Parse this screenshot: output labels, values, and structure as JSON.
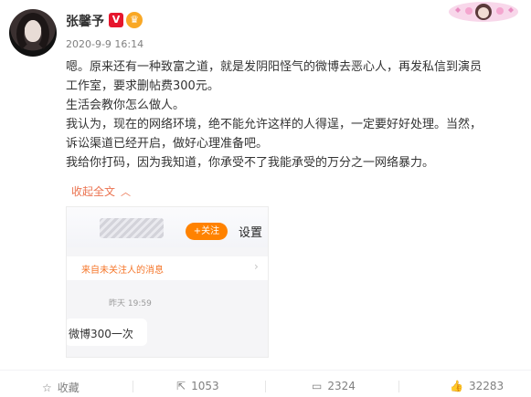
{
  "user": {
    "name": "张馨予",
    "verified_badge": "V",
    "fan_badge": "♛",
    "timestamp": "2020-9-9 16:14"
  },
  "post": {
    "lines": [
      "嗯。原来还有一种致富之道，就是发阴阳怪气的微博去恶心人，再发私信到演员",
      "工作室，要求删帖费300元。",
      "生活会教你怎么做人。",
      "我认为，现在的网络环境，绝不能允许这样的人得逞，一定要好好处理。当然，",
      "诉讼渠道已经开启，做好心理准备吧。",
      "我给你打码，因为我知道，你承受不了我能承受的万分之一网络暴力。"
    ],
    "collapse_label": "收起全文",
    "collapse_icon": "chevron-up-icon"
  },
  "screenshot": {
    "follow_label": "+关注",
    "settings_label": "设置",
    "notice_text": "来自未关注人的消息",
    "chat_time": "昨天 19:59",
    "message": "微博300一次"
  },
  "footer": {
    "favorite_label": "收藏",
    "repost_count": "1053",
    "comment_count": "2324",
    "like_count": "32283"
  },
  "colors": {
    "accent": "#eb7350",
    "follow_button": "#ff8200",
    "verified": "#e6162d"
  }
}
